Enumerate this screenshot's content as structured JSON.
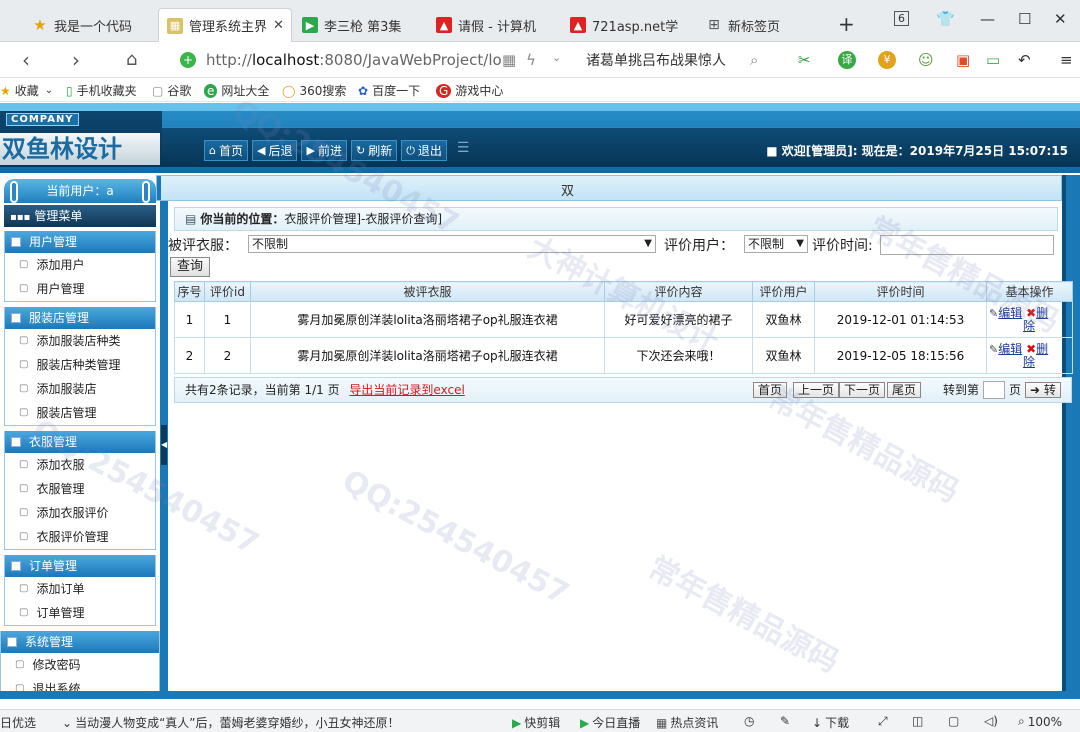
{
  "browser": {
    "tabs": [
      {
        "title": "我是一个代码",
        "active": false
      },
      {
        "title": "管理系统主界",
        "active": true
      },
      {
        "title": "李三枪 第3集",
        "active": false
      },
      {
        "title": "请假 - 计算机",
        "active": false
      },
      {
        "title": "721asp.net学",
        "active": false
      },
      {
        "title": "新标签页",
        "active": false
      }
    ],
    "tab_count": "6",
    "url_prefix": "http://",
    "url_host": "localhost",
    "url_rest": ":8080/JavaWebProject/lo",
    "search_text": "诸葛单挑吕布战果惊人",
    "bookmarks": [
      "收藏",
      "手机收藏夹",
      "谷歌",
      "网址大全",
      "360搜索",
      "百度一下",
      "游戏中心"
    ]
  },
  "app": {
    "company": "COMPANY",
    "brand": "双鱼林设计",
    "nav": [
      {
        "icon": "home-icon",
        "label": "首页"
      },
      {
        "icon": "back-icon",
        "label": "后退"
      },
      {
        "icon": "forward-icon",
        "label": "前进"
      },
      {
        "icon": "refresh-icon",
        "label": "刷新"
      },
      {
        "icon": "power-icon",
        "label": "退出"
      }
    ],
    "welcome": "欢迎[管理员]:  现在是：2019年7月25日 15:07:15",
    "current_user": "当前用户：a",
    "menu_title": "管理菜单",
    "groups": [
      {
        "title": "用户管理",
        "items": [
          "添加用户",
          "用户管理"
        ]
      },
      {
        "title": "服装店管理",
        "items": [
          "添加服装店种类",
          "服装店种类管理",
          "添加服装店",
          "服装店管理"
        ]
      },
      {
        "title": "衣服管理",
        "items": [
          "添加衣服",
          "衣服管理",
          "添加衣服评价",
          "衣服评价管理"
        ]
      },
      {
        "title": "订单管理",
        "items": [
          "添加订单",
          "订单管理"
        ]
      },
      {
        "title": "系统管理",
        "items": [
          "修改密码",
          "退出系统"
        ]
      }
    ],
    "subbar_text": "双"
  },
  "content": {
    "crumb_label": "你当前的位置：",
    "crumb_path": "衣服评价管理]-衣服评价查询]",
    "filter": {
      "clothes_label": "被评衣服：",
      "clothes_value": "不限制",
      "user_label": "评价用户：",
      "user_value": "不限制",
      "time_label": "评价时间:",
      "time_value": ""
    },
    "query_button": "查询",
    "columns": [
      "序号",
      "评价id",
      "被评衣服",
      "评价内容",
      "评价用户",
      "评价时间",
      "基本操作"
    ],
    "rows": [
      {
        "no": "1",
        "id": "1",
        "clothes": "雾月加冕原创洋装lolita洛丽塔裙子op礼服连衣裙",
        "content": "好可爱好漂亮的裙子",
        "user": "双鱼林",
        "time": "2019-12-01 01:14:53"
      },
      {
        "no": "2",
        "id": "2",
        "clothes": "雾月加冕原创洋装lolita洛丽塔裙子op礼服连衣裙",
        "content": "下次还会来哦！",
        "user": "双鱼林",
        "time": "2019-12-05 18:15:56"
      }
    ],
    "op_edit": "编辑",
    "op_delete_a": "删",
    "op_delete_b": "除",
    "pager": {
      "summary": "共有2条记录，当前第 1/1 页",
      "export": "导出当前记录到excel",
      "first": "首页",
      "prev": "上一页",
      "next": "下一页",
      "last": "尾页",
      "goto": "转到第",
      "page_unit": "页",
      "go": "转"
    }
  },
  "statusbar": {
    "left": "日优选",
    "news": "当动漫人物变成“真人”后，蕾姆老婆穿婚纱，小丑女神还原！",
    "items": [
      "快剪辑",
      "今日直播",
      "热点资讯",
      "下载"
    ],
    "zoom": "100%"
  },
  "watermarks": [
    "常年售精品源码",
    "QQ:254540457",
    "大神计算机设计"
  ]
}
